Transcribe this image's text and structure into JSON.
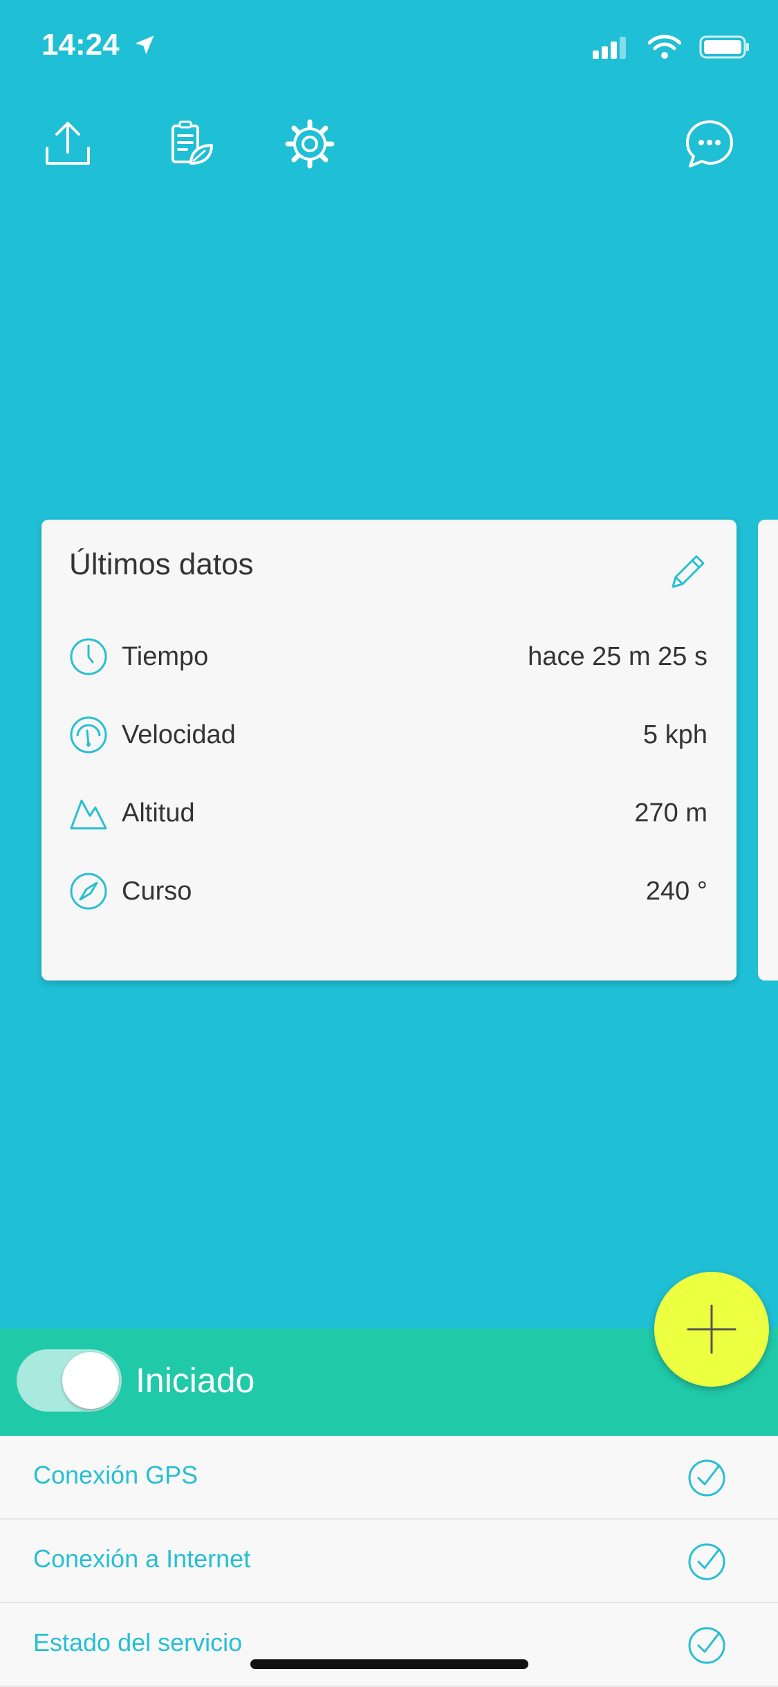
{
  "status_bar": {
    "time": "14:24"
  },
  "card": {
    "title": "Últimos datos",
    "rows": [
      {
        "label": "Tiempo",
        "value": "hace 25 m 25 s",
        "icon": "clock-icon"
      },
      {
        "label": "Velocidad",
        "value": "5 kph",
        "icon": "speedometer-icon"
      },
      {
        "label": "Altitud",
        "value": "270 m",
        "icon": "mountain-icon"
      },
      {
        "label": "Curso",
        "value": "240 °",
        "icon": "compass-icon"
      }
    ]
  },
  "toggle": {
    "label": "Iniciado",
    "on": true
  },
  "status_list": [
    {
      "label": "Conexión GPS",
      "ok": true
    },
    {
      "label": "Conexión a Internet",
      "ok": true
    },
    {
      "label": "Estado del servicio",
      "ok": true
    }
  ],
  "colors": {
    "background": "#1fbfd5",
    "accent_green": "#20c9a8",
    "fab": "#ecff40",
    "text_accent": "#27bfd2"
  }
}
